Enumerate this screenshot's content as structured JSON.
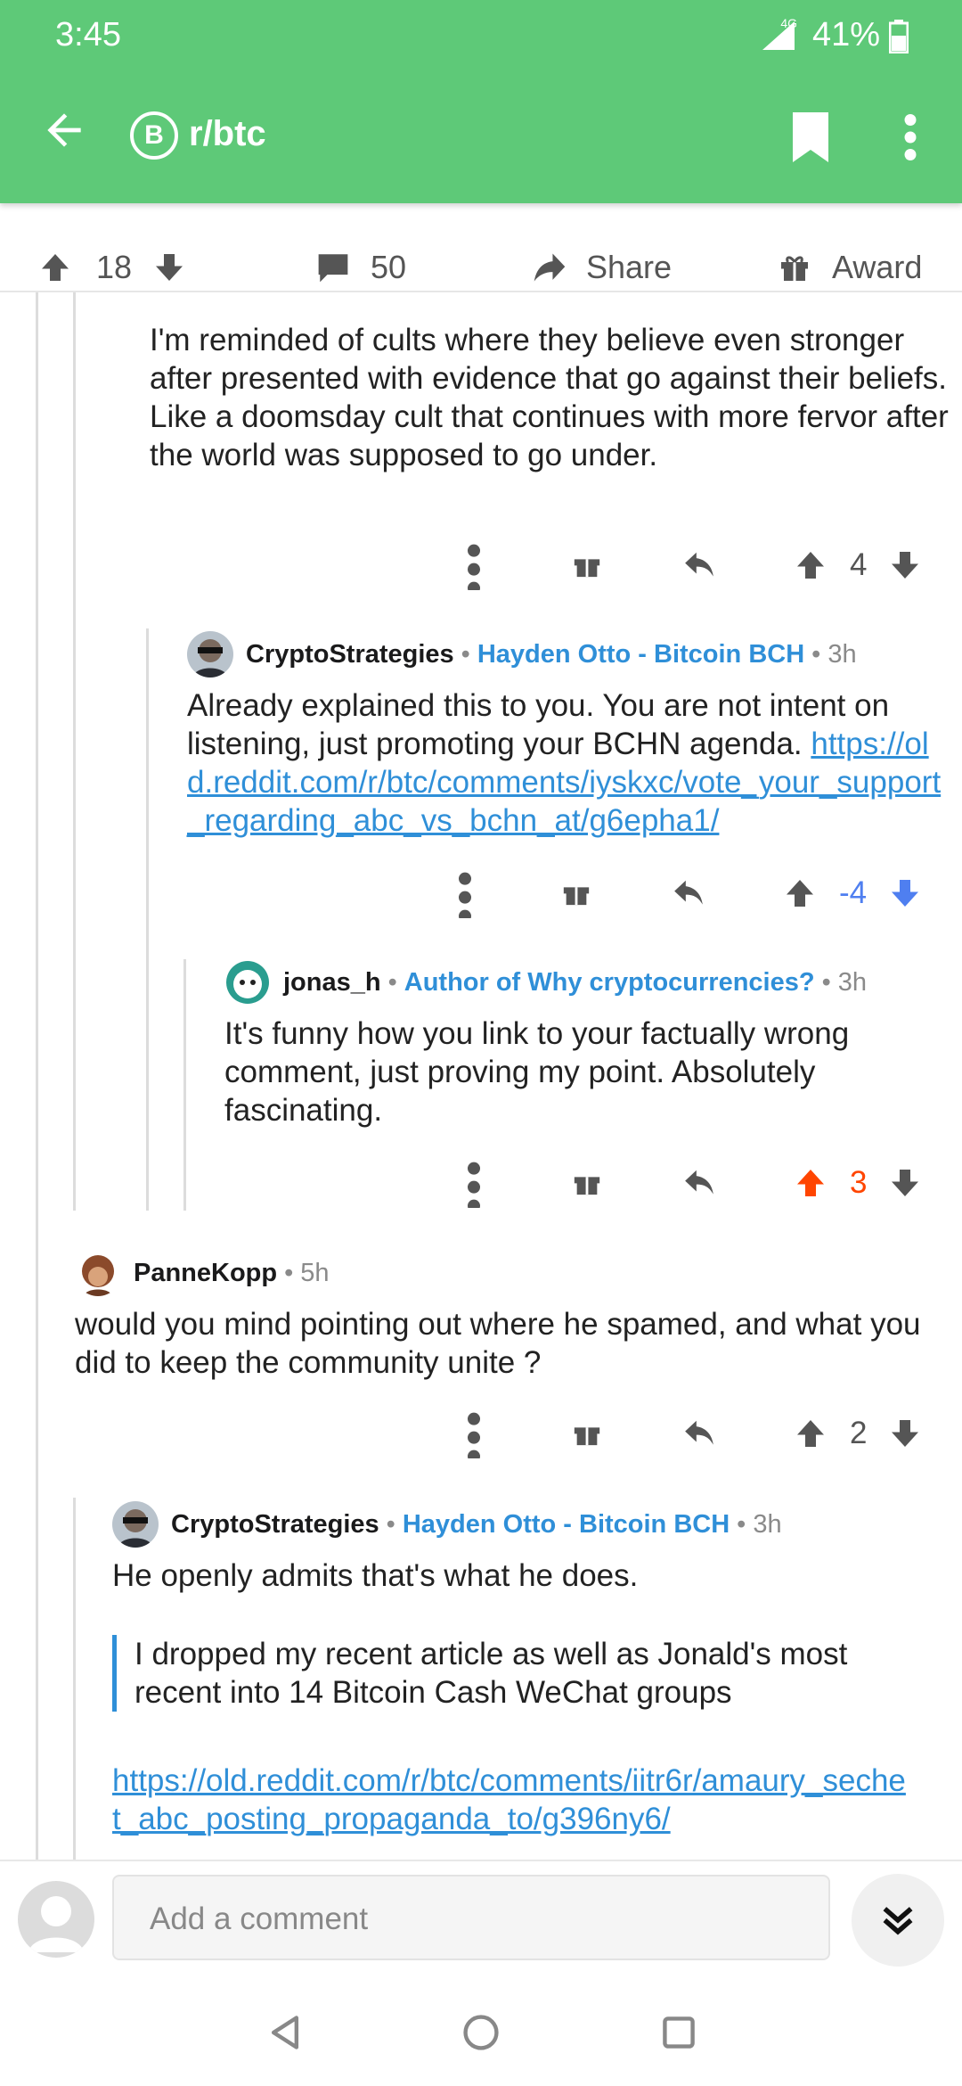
{
  "status": {
    "time": "3:45",
    "network": "4G",
    "battery": "41%"
  },
  "appbar": {
    "subreddit": "r/btc",
    "sub_icon_letter": "B"
  },
  "post_actions": {
    "score": "18",
    "comments": "50",
    "share": "Share",
    "award": "Award"
  },
  "comments": [
    {
      "body": "I'm reminded of cults where they believe even stronger after presented with evidence that go against their beliefs. Like a doomsday cult that continues with more fervor after the world was supposed to go under.",
      "score": "4"
    },
    {
      "user": "CryptoStrategies",
      "flair": "Hayden Otto - Bitcoin BCH",
      "age": "3h",
      "body": "Already explained this to you. You are not intent on listening, just promoting your BCHN agenda. ",
      "link": "https://old.reddit.com/r/btc/comments/iyskxc/vote_your_support_regarding_abc_vs_bchn_at/g6epha1/",
      "score": "-4"
    },
    {
      "user": "jonas_h",
      "flair": "Author of Why cryptocurrencies?",
      "age": "3h",
      "body": "It's funny how you link to your factually wrong comment, just proving my point. Absolutely fascinating.",
      "score": "3"
    },
    {
      "user": "PanneKopp",
      "age": "5h",
      "body": "would you mind pointing out where he spamed, and what you did to keep the community unite ?",
      "score": "2"
    },
    {
      "user": "CryptoStrategies",
      "flair": "Hayden Otto - Bitcoin BCH",
      "age": "3h",
      "body": "He openly admits that's what he does.",
      "quote": "I dropped my recent article as well as Jonald's most recent into 14 Bitcoin Cash WeChat groups",
      "link": "https://old.reddit.com/r/btc/comments/iitr6r/amaury_sechet_abc_posting_propaganda_to/g396ny6/"
    }
  ],
  "comment_input": {
    "placeholder": "Add a comment"
  },
  "colors": {
    "appbar": "#5ec978",
    "link": "#2f8fd8",
    "upvote": "#ff4500",
    "downvote": "#4f7ff0",
    "icon": "#555555"
  },
  "icons": [
    "back-arrow-icon",
    "bitcoin-icon",
    "bookmark-icon",
    "more-vert-icon",
    "upvote-icon",
    "downvote-icon",
    "comment-icon",
    "share-icon",
    "gift-icon",
    "reply-icon",
    "chevron-double-down-icon"
  ]
}
